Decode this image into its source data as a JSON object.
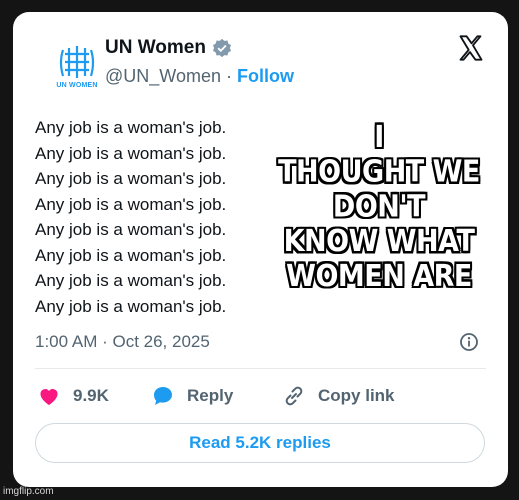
{
  "account": {
    "name": "UN Women",
    "handle": "@UN_Women",
    "separator": "·",
    "follow_label": "Follow",
    "logo_text": "UN WOMEN",
    "verified_color": "#829aab"
  },
  "tweet": {
    "lines": [
      "Any job is a woman's job.",
      "Any job is a woman's job.",
      "Any job is a woman's job.",
      "Any job is a woman's job.",
      "Any job is a woman's job.",
      "Any job is a woman's job.",
      "Any job is a woman's job.",
      "Any job is a woman's job."
    ],
    "timestamp": "1:00 AM · Oct 26, 2025"
  },
  "meme_caption": {
    "lines": [
      "I",
      "THOUGHT WE",
      "DON'T",
      "KNOW WHAT",
      "WOMEN ARE"
    ]
  },
  "actions": {
    "like_count": "9.9K",
    "reply_label": "Reply",
    "copy_link_label": "Copy link"
  },
  "read_replies_label": "Read 5.2K replies",
  "watermark": "imgflip.com",
  "colors": {
    "accent": "#1d9bf0",
    "like": "#f91880",
    "text": "#0f1419",
    "secondary": "#536471"
  },
  "icons": [
    "un-women-logo-icon",
    "verified-badge-icon",
    "x-logo-icon",
    "info-icon",
    "heart-icon",
    "reply-bubble-icon",
    "link-icon"
  ]
}
